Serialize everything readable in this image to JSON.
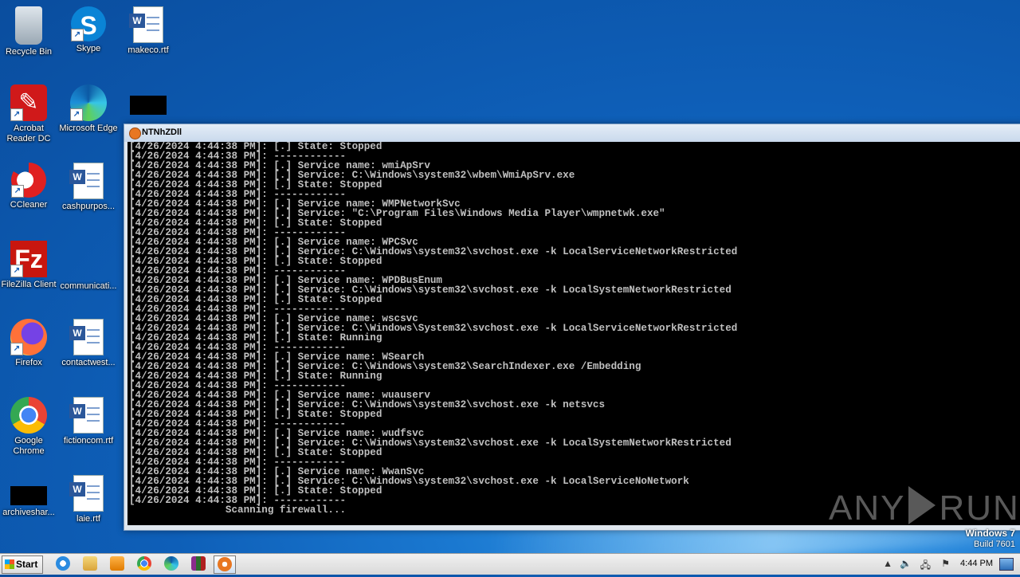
{
  "desktop_icons": [
    {
      "label": "Recycle Bin",
      "icon": "recycle-bin-icon"
    },
    {
      "label": "Skype",
      "icon": "skype-icon"
    },
    {
      "label": "makeco.rtf",
      "icon": "word-document-icon"
    },
    {
      "label": "Acrobat Reader DC",
      "icon": "acrobat-icon"
    },
    {
      "label": "Microsoft Edge",
      "icon": "edge-icon"
    },
    {
      "label": "",
      "icon": "redacted-icon"
    },
    {
      "label": "CCleaner",
      "icon": "ccleaner-icon"
    },
    {
      "label": "cashpurpos...",
      "icon": "word-document-icon"
    },
    {
      "label": "FileZilla Client",
      "icon": "filezilla-icon"
    },
    {
      "label": "communicati...",
      "icon": "blank-file-icon"
    },
    {
      "label": "Firefox",
      "icon": "firefox-icon"
    },
    {
      "label": "contactwest...",
      "icon": "word-document-icon"
    },
    {
      "label": "Google Chrome",
      "icon": "chrome-icon"
    },
    {
      "label": "fictioncom.rtf",
      "icon": "word-document-icon"
    },
    {
      "label": "archiveshar...",
      "icon": "redacted-icon"
    },
    {
      "label": "laie.rtf",
      "icon": "word-document-icon"
    }
  ],
  "window": {
    "title": "NTNhZDll",
    "console_lines": [
      "[4/26/2024 4:44:38 PM]: [.] State: Stopped",
      "[4/26/2024 4:44:38 PM]: ------------",
      "[4/26/2024 4:44:38 PM]: [.] Service name: wmiApSrv",
      "[4/26/2024 4:44:38 PM]: [.] Service: C:\\Windows\\system32\\wbem\\WmiApSrv.exe",
      "[4/26/2024 4:44:38 PM]: [.] State: Stopped",
      "[4/26/2024 4:44:38 PM]: ------------",
      "[4/26/2024 4:44:38 PM]: [.] Service name: WMPNetworkSvc",
      "[4/26/2024 4:44:38 PM]: [.] Service: \"C:\\Program Files\\Windows Media Player\\wmpnetwk.exe\"",
      "[4/26/2024 4:44:38 PM]: [.] State: Stopped",
      "[4/26/2024 4:44:38 PM]: ------------",
      "[4/26/2024 4:44:38 PM]: [.] Service name: WPCSvc",
      "[4/26/2024 4:44:38 PM]: [.] Service: C:\\Windows\\system32\\svchost.exe -k LocalServiceNetworkRestricted",
      "[4/26/2024 4:44:38 PM]: [.] State: Stopped",
      "[4/26/2024 4:44:38 PM]: ------------",
      "[4/26/2024 4:44:38 PM]: [.] Service name: WPDBusEnum",
      "[4/26/2024 4:44:38 PM]: [.] Service: C:\\Windows\\system32\\svchost.exe -k LocalSystemNetworkRestricted",
      "[4/26/2024 4:44:38 PM]: [.] State: Stopped",
      "[4/26/2024 4:44:38 PM]: ------------",
      "[4/26/2024 4:44:38 PM]: [.] Service name: wscsvc",
      "[4/26/2024 4:44:38 PM]: [.] Service: C:\\Windows\\System32\\svchost.exe -k LocalServiceNetworkRestricted",
      "[4/26/2024 4:44:38 PM]: [.] State: Running",
      "[4/26/2024 4:44:38 PM]: ------------",
      "[4/26/2024 4:44:38 PM]: [.] Service name: WSearch",
      "[4/26/2024 4:44:38 PM]: [.] Service: C:\\Windows\\system32\\SearchIndexer.exe /Embedding",
      "[4/26/2024 4:44:38 PM]: [.] State: Running",
      "[4/26/2024 4:44:38 PM]: ------------",
      "[4/26/2024 4:44:38 PM]: [.] Service name: wuauserv",
      "[4/26/2024 4:44:38 PM]: [.] Service: C:\\Windows\\system32\\svchost.exe -k netsvcs",
      "[4/26/2024 4:44:38 PM]: [.] State: Stopped",
      "[4/26/2024 4:44:38 PM]: ------------",
      "[4/26/2024 4:44:38 PM]: [.] Service name: wudfsvc",
      "[4/26/2024 4:44:38 PM]: [.] Service: C:\\Windows\\system32\\svchost.exe -k LocalSystemNetworkRestricted",
      "[4/26/2024 4:44:38 PM]: [.] State: Stopped",
      "[4/26/2024 4:44:38 PM]: ------------",
      "[4/26/2024 4:44:38 PM]: [.] Service name: WwanSvc",
      "[4/26/2024 4:44:38 PM]: [.] Service: C:\\Windows\\system32\\svchost.exe -k LocalServiceNoNetwork",
      "[4/26/2024 4:44:38 PM]: [.] State: Stopped",
      "[4/26/2024 4:44:38 PM]: ------------"
    ],
    "status_line": "                Scanning firewall...",
    "colors": {
      "console_bg": "#000000",
      "console_text": "#c0c0c0",
      "status_text": "#30c8c8"
    }
  },
  "watermark": {
    "left": "ANY",
    "right": "RUN"
  },
  "os_version": {
    "line1": "Windows 7",
    "line2": "Build 7601"
  },
  "taskbar": {
    "start_label": "Start",
    "apps": [
      "internet-explorer-icon",
      "explorer-icon",
      "media-player-icon",
      "chrome-icon",
      "edge-icon",
      "winrar-icon",
      "ntnhzdll-icon"
    ],
    "clock": "4:44 PM"
  }
}
